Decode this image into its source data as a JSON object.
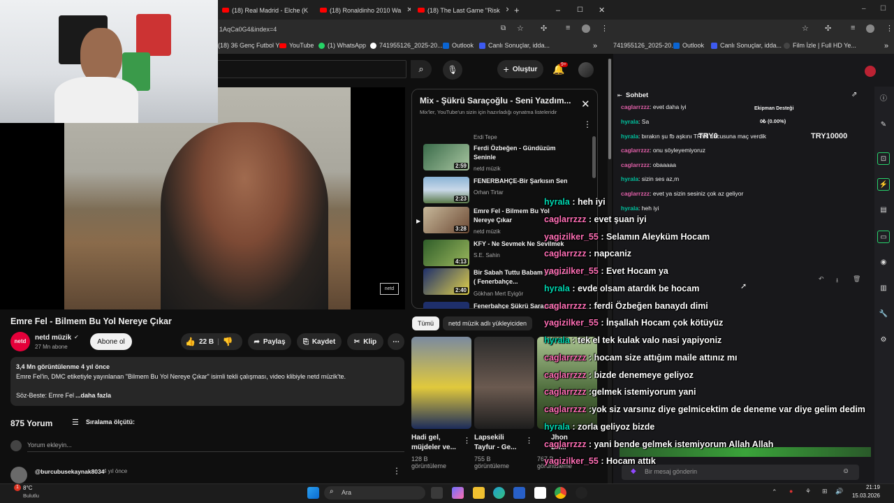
{
  "browser": {
    "tabs": [
      {
        "title": "(18) Real Madrid - Elche (K"
      },
      {
        "title": "(18) Ronaldinho 2010 Wa"
      },
      {
        "title": "(18) The Last Game \"Risk"
      }
    ],
    "url": "1AqCa0G4&index=4",
    "bookmarks": [
      "(18) 36 Genç Futbol Y...",
      "YouTube",
      "(1) WhatsApp",
      "741955126_2025-20...",
      "Outlook",
      "Canlı Sonuçlar, idda..."
    ]
  },
  "youtube": {
    "create_label": "Oluştur",
    "notif_count": "9+",
    "video_title": "Emre Fel - Bilmem Bu Yol Nereye Çıkar",
    "watermark": "netd",
    "channel": {
      "name": "netd müzik",
      "subs": "27 Mn abone",
      "avatar_text": "netd"
    },
    "subscribe_label": "Abone ol",
    "likes": "22 B",
    "share_label": "Paylaş",
    "save_label": "Kaydet",
    "clip_label": "Klip",
    "description": {
      "meta": "3,4 Mn görüntülenme  4 yıl önce",
      "text": "Emre Fel'in, DMC etiketiyle yayınlanan \"Bilmem Bu Yol Nereye Çıkar\" isimli tekli çalışması, video klibiyle netd müzik'te.",
      "credit": "Söz-Beste: Emre Fel",
      "more": "...daha fazla"
    },
    "comments": {
      "count": "875 Yorum",
      "sort_label": "Sıralama ölçütü:",
      "placeholder": "Yorum ekleyin...",
      "first_author": "@burcubusekaynak8034",
      "first_time": "4 yıl önce"
    },
    "playlist": {
      "title": "Mix - Şükrü Saraçoğlu - Seni Yazdım...",
      "subtitle": "Mix'ler, YouTube'un sizin için hazırladığı oynatma listeleridir",
      "top_channel": "Erdi Tepe",
      "items": [
        {
          "title": "Ferdi Özbeğen - Gündüzüm Seninle",
          "channel": "netd müzik",
          "duration": "2:59"
        },
        {
          "title": "FENERBAHÇE-Bir Şarkısın Sen",
          "channel": "Orhan Tirtar",
          "duration": "2:23"
        },
        {
          "title": "Emre Fel - Bilmem Bu Yol Nereye Çıkar",
          "channel": "netd müzik",
          "duration": "3:28"
        },
        {
          "title": "KFY - Ne Sevmek Ne Sevilmek",
          "channel": "S.E. Sahin",
          "duration": "4:13"
        },
        {
          "title": "Bir Sabah Tuttu Babam Elimden ( Fenerbahçe...",
          "channel": "Gökhan Mert Eyigör",
          "duration": "2:40"
        },
        {
          "title": "Fenerbahçe Şükrü Saraçoğlu",
          "channel": "",
          "duration": ""
        }
      ]
    },
    "chips": [
      "Tümü",
      "netd müzik adlı yükleyiciden"
    ],
    "grid": [
      {
        "title1": "Hadi gel,",
        "title2": "müjdeler ve...",
        "views1": "128 B",
        "views2": "görüntüleme"
      },
      {
        "title1": "Lapsekili",
        "title2": "Tayfur - Ge...",
        "views1": "755 B",
        "views2": "görüntüleme"
      },
      {
        "title1": "Jhon",
        "title2": "Du...",
        "views1": "767 B",
        "views2": "görüntüleme"
      }
    ]
  },
  "twitch": {
    "bookmarks": [
      "741955126_2025-20...",
      "Outlook",
      "Canlı Sonuçlar, idda...",
      "Film İzle | Full HD Ye..."
    ],
    "chat_title": "Sohbet",
    "widget_title": "Ekipman Desteği",
    "widget_value": "0₺ (0.00%)",
    "widget_left": "TRY0",
    "widget_right": "TRY10000",
    "chat": [
      {
        "user": "caglarrzzz",
        "msg": "evet daha iyi",
        "c": "#e05fa8"
      },
      {
        "user": "hyrala",
        "msg": "Sa",
        "c": "#00c19e"
      },
      {
        "user": "hyrala",
        "msg": "bırakın şu fb aşkını TRY0 uncusuna maç verdik",
        "c": "#00c19e"
      },
      {
        "user": "caglarrzzz",
        "msg": "onu söyleyemiyoruz",
        "c": "#e05fa8"
      },
      {
        "user": "caglarrzzz",
        "msg": "obaaaaa",
        "c": "#e05fa8"
      },
      {
        "user": "hyrala",
        "msg": "sizin ses az,m",
        "c": "#00c19e"
      },
      {
        "user": "caglarrzzz",
        "msg": "evet ya sizin sesiniz çok az geliyor",
        "c": "#e05fa8"
      },
      {
        "user": "hyrala",
        "msg": "heh iyi",
        "c": "#00c19e"
      }
    ],
    "chat_input_placeholder": "Bir mesaj gönderin"
  },
  "overlay": [
    {
      "user": "hyrala",
      "msg": " : heh iyi",
      "c": "#00d7b0"
    },
    {
      "user": "caglarrzzz",
      "msg": " : evet şuan iyi",
      "c": "#ff6fb5"
    },
    {
      "user": "yagizilker_55",
      "msg": " : Selamın Aleyküm Hocam",
      "c": "#ff6fb5"
    },
    {
      "user": "caglarrzzz",
      "msg": " : napcaniz",
      "c": "#ff6fb5"
    },
    {
      "user": "yagizilker_55",
      "msg": " : Evet Hocam ya",
      "c": "#ff6fb5"
    },
    {
      "user": "hyrala",
      "msg": " : evde olsam atardık be hocam",
      "c": "#00d7b0"
    },
    {
      "user": "caglarrzzz",
      "msg": " : ferdi Özbeğen banaydı dimi",
      "c": "#ff6fb5"
    },
    {
      "user": "yagizilker_55",
      "msg": " : İnşallah Hocam çok kötüyüz",
      "c": "#ff6fb5"
    },
    {
      "user": "hyrala",
      "msg": " : tek el tek kulak valo nasi yapiyoniz",
      "c": "#00d7b0"
    },
    {
      "user": "caglarrzzz",
      "msg": " : hocam size attığım maile attınız mı",
      "c": "#ff6fb5"
    },
    {
      "user": "caglarrzzz",
      "msg": " : bizde denemeye geliyoz",
      "c": "#ff6fb5"
    },
    {
      "user": "caglarrzzz",
      "msg": " :gelmek istemiyorum yani",
      "c": "#ff6fb5"
    },
    {
      "user": "caglarrzzz",
      "msg": " :yok siz varsınız diye gelmicektim de deneme var diye gelim dedim",
      "c": "#ff6fb5"
    },
    {
      "user": "hyrala",
      "msg": " : zorla geliyoz bizde",
      "c": "#00d7b0"
    },
    {
      "user": "caglarrzzz",
      "msg": " : yani bende gelmek istemiyorum Allah Allah",
      "c": "#ff6fb5"
    },
    {
      "user": "yagizilker_55",
      "msg": " : Hocam attık",
      "c": "#ff6fb5"
    }
  ],
  "taskbar": {
    "weather": "8°C",
    "weather_sub": "Bulutlu",
    "search": "Ara",
    "time": "21:19",
    "date": "15.03.2026"
  }
}
